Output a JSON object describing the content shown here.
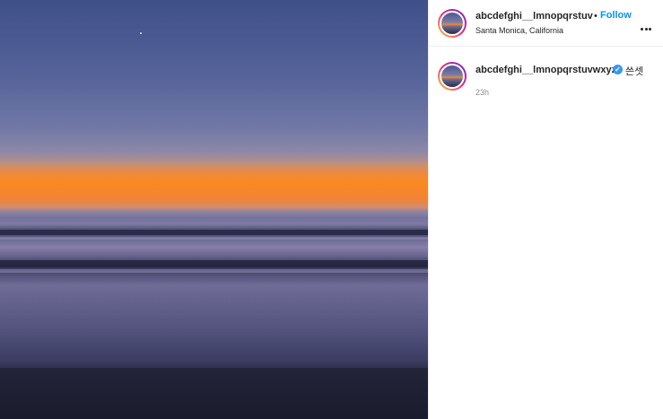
{
  "post": {
    "image_alt": "Sunset over the ocean",
    "author": {
      "username": "abcdefghi__lmnopqrstuvwxyz",
      "username_truncated": "abcdefghi__lmnopqrstuvv",
      "separator": "•",
      "follow_label": "Follow",
      "location": "Santa Monica, California",
      "verified": true
    },
    "more_icon": "more-horizontal-icon",
    "caption": {
      "username": "abcdefghi__lmnopqrstuvwxyz",
      "text": "쓴셋",
      "timestamp": "23h"
    }
  },
  "colors": {
    "follow": "#0095f6",
    "verified": "#3897f0",
    "muted_text": "#8e8e8e"
  }
}
